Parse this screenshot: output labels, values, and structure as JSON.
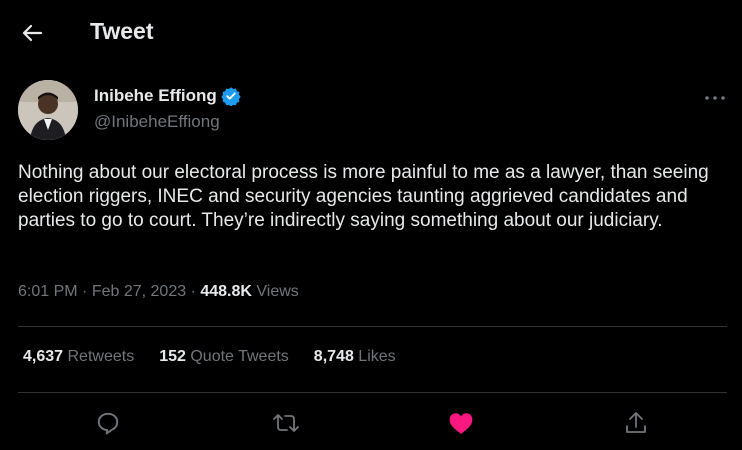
{
  "header": {
    "title": "Tweet",
    "back_icon": "arrow-left-icon"
  },
  "author": {
    "name": "Inibehe Effiong",
    "handle": "@InibeheEffiong",
    "verified_icon": "verified-badge-icon",
    "verified_color": "#1d9bf0"
  },
  "tweet": {
    "text": "Nothing about our electoral process is more painful to me as a lawyer, than seeing election riggers, INEC and security agencies taunting aggrieved candidates and parties to go to court. They’re indirectly saying something about our judiciary.",
    "time": "6:01 PM",
    "date": "Feb 27, 2023",
    "views_count": "448.8K",
    "views_label": "Views"
  },
  "stats": {
    "retweets_count": "4,637",
    "retweets_label": "Retweets",
    "quotes_count": "152",
    "quotes_label": "Quote Tweets",
    "likes_count": "8,748",
    "likes_label": "Likes"
  },
  "actions": [
    {
      "icon": "reply-icon"
    },
    {
      "icon": "retweet-icon"
    },
    {
      "icon": "like-icon",
      "color": "#f91880",
      "active": true
    },
    {
      "icon": "share-icon"
    }
  ],
  "colors": {
    "background": "#000000",
    "text": "#e7e9ea",
    "secondary": "#71767b",
    "divider": "#2f3336",
    "like": "#f91880"
  }
}
